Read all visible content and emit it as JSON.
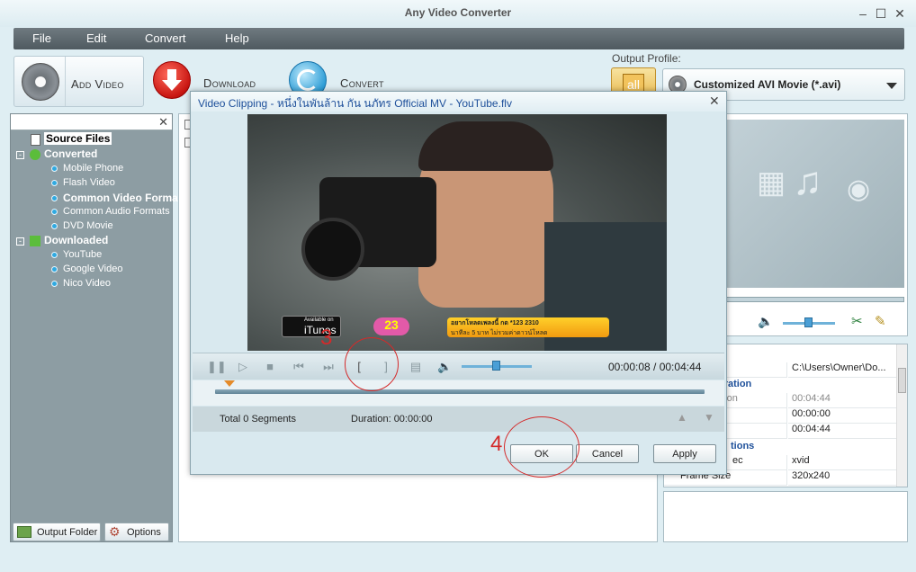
{
  "window": {
    "title": "Any Video Converter"
  },
  "menu": [
    "File",
    "Edit",
    "Convert",
    "Help"
  ],
  "toolbar": {
    "add_video": "Add Video",
    "download": "Download",
    "convert": "Convert"
  },
  "output_profile": {
    "label": "Output Profile:",
    "all_button": "all",
    "selected": "Customized AVI Movie (*.avi)"
  },
  "sidebar": {
    "root": "Source Files",
    "converted": {
      "label": "Converted",
      "items": [
        "Mobile Phone",
        "Flash Video",
        "Common Video Formats",
        "Common Audio Formats",
        "DVD Movie"
      ]
    },
    "downloaded": {
      "label": "Downloaded",
      "items": [
        "YouTube",
        "Google Video",
        "Nico Video"
      ]
    },
    "output_folder": "Output Folder",
    "options": "Options"
  },
  "properties": {
    "path_value": "C:\\Users\\Owner\\Do...",
    "duration_header": "uration",
    "duration_label": "ation",
    "duration_value": "00:04:44",
    "start_value": "00:00:00",
    "end_value": "00:04:44",
    "options_header": "tions",
    "codec_label": "ec",
    "codec_value": "xvid",
    "frame_label": "Frame Size",
    "frame_value": "320x240"
  },
  "dialog": {
    "title": "Video  Clipping  - หนึ่งในพันล้าน กัน นภัทร Official MV - YouTube.flv",
    "time": "00:00:08 / 00:04:44",
    "total_segments": "Total 0 Segments",
    "duration": "Duration: 00:00:00",
    "ok": "OK",
    "cancel": "Cancel",
    "apply": "Apply",
    "volume_fraction": 0.5,
    "video_overlay": {
      "itunes_small": "Available on",
      "itunes": "iTunes",
      "num": "23",
      "promo": "อยากโหลดเพลงนี้ กด *123 2310",
      "promo_sub": "นาทีละ 5 บาท ไม่รวมค่าดาวน์โหลด"
    }
  },
  "annotations": {
    "step3": "3",
    "step4": "4"
  },
  "colors": {
    "accent": "#1d4f9a",
    "annotation": "#d42a2a",
    "menubar": "#5a656b"
  }
}
